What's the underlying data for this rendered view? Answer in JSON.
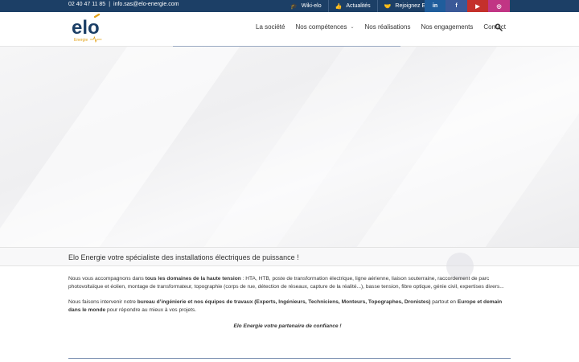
{
  "topbar": {
    "phone": "02 40 47 11 85",
    "separator": "|",
    "email": "info.sas@elo-energie.com",
    "links": [
      {
        "icon": "graduation-cap-icon",
        "label": "Wiki-elo"
      },
      {
        "icon": "thumbs-up-icon",
        "label": "Actualités"
      },
      {
        "icon": "handshake-icon",
        "label": "Rejoignez ELO"
      }
    ],
    "socials": [
      {
        "name": "linkedin",
        "glyph": "in",
        "color": "#1f5d9c"
      },
      {
        "name": "facebook",
        "glyph": "f",
        "color": "#3b5998"
      },
      {
        "name": "youtube",
        "glyph": "▶",
        "color": "#c4302b"
      },
      {
        "name": "instagram",
        "glyph": "◎",
        "color": "#c13584"
      }
    ],
    "background": "#1c3f66"
  },
  "logo": {
    "word": "elo",
    "sub": "Energie",
    "color": "#1c3f66",
    "accent": "#e3a21a"
  },
  "nav": {
    "items": [
      {
        "label": "La société"
      },
      {
        "label": "Nos compétences",
        "has_dropdown": true
      },
      {
        "label": "Nos réalisations"
      },
      {
        "label": "Nos engagements"
      },
      {
        "label": "Contact"
      }
    ],
    "search_icon": "search-icon"
  },
  "band": {
    "title": "Elo Energie votre spécialiste des installations électriques de puissance !"
  },
  "content": {
    "p1_a": "Nous vous accompagnons dans ",
    "p1_b": "tous les domaines de la haute tension",
    "p1_c": " : HTA, HTB, poste de transformation électrique, ligne aérienne, liaison souterraine, raccordement de parc photovoltaïque et éolien, montage de transformateur, topographie (corps de rue, détection de réseaux, capture de la réalité...), basse tension, fibre optique, génie civil, expertises divers...",
    "p2_a": "Nous faisons intervenir notre ",
    "p2_b": "bureau d’ingénierie et nos équipes de travaux (Experts, Ingénieurs, Techniciens, Monteurs,  Topographes, Dronistes)",
    "p2_c": " partout en ",
    "p2_d": "Europe et demain dans le monde",
    "p2_e": " pour répondre au mieux à vos projets.",
    "slogan": "Elo Energie votre partenaire de confiance !"
  }
}
